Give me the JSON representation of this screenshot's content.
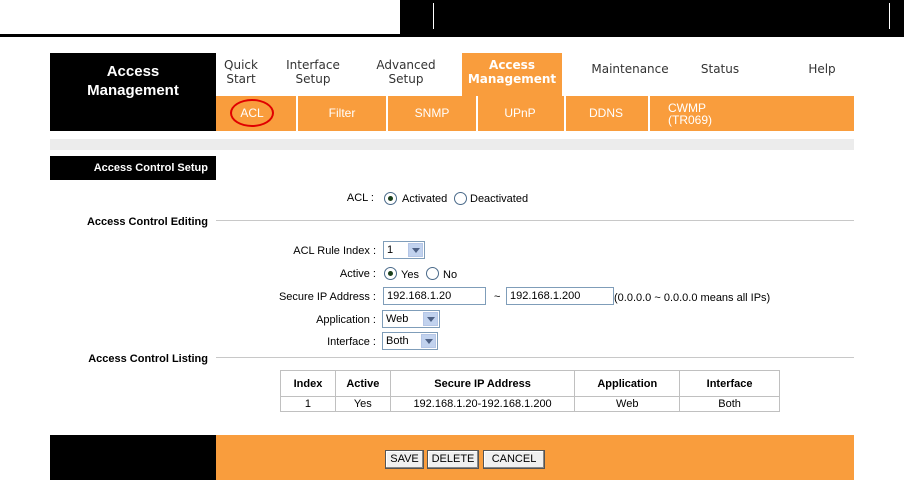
{
  "brand": {
    "line1": "Access",
    "line2": "Management"
  },
  "nav": [
    {
      "line1": "Quick",
      "line2": "Start"
    },
    {
      "line1": "Interface",
      "line2": "Setup"
    },
    {
      "line1": "Advanced",
      "line2": "Setup"
    },
    {
      "line1": "Access",
      "line2": "Management",
      "active": true
    },
    {
      "line1": "Maintenance",
      "line2": ""
    },
    {
      "line1": "Status",
      "line2": ""
    },
    {
      "line1": "Help",
      "line2": ""
    }
  ],
  "subnav": [
    {
      "line1": "ACL",
      "line2": ""
    },
    {
      "line1": "Filter",
      "line2": ""
    },
    {
      "line1": "SNMP",
      "line2": ""
    },
    {
      "line1": "UPnP",
      "line2": ""
    },
    {
      "line1": "DDNS",
      "line2": ""
    },
    {
      "line1": "CWMP",
      "line2": "(TR069)"
    }
  ],
  "sections": {
    "setup": "Access Control Setup",
    "editing": "Access Control Editing",
    "listing": "Access Control Listing"
  },
  "setup": {
    "acl_label": "ACL :",
    "activated": "Activated",
    "deactivated": "Deactivated",
    "selected": "Activated"
  },
  "editing": {
    "rule_index_label": "ACL Rule Index :",
    "rule_index_value": "1",
    "active_label": "Active :",
    "yes": "Yes",
    "no": "No",
    "active_selected": "Yes",
    "secure_ip_label": "Secure IP Address :",
    "ip_start": "192.168.1.20",
    "ip_sep": "~",
    "ip_end": "192.168.1.200",
    "ip_hint": "(0.0.0.0 ~ 0.0.0.0 means all IPs)",
    "application_label": "Application :",
    "application_value": "Web",
    "interface_label": "Interface :",
    "interface_value": "Both"
  },
  "listing": {
    "headers": [
      "Index",
      "Active",
      "Secure IP Address",
      "Application",
      "Interface"
    ],
    "rows": [
      [
        "1",
        "Yes",
        "192.168.1.20-192.168.1.200",
        "Web",
        "Both"
      ]
    ]
  },
  "buttons": {
    "save": "SAVE",
    "delete": "DELETE",
    "cancel": "CANCEL"
  },
  "colors": {
    "accent": "#f99d3d",
    "dark": "#000000",
    "highlight_circle": "#e00000"
  }
}
